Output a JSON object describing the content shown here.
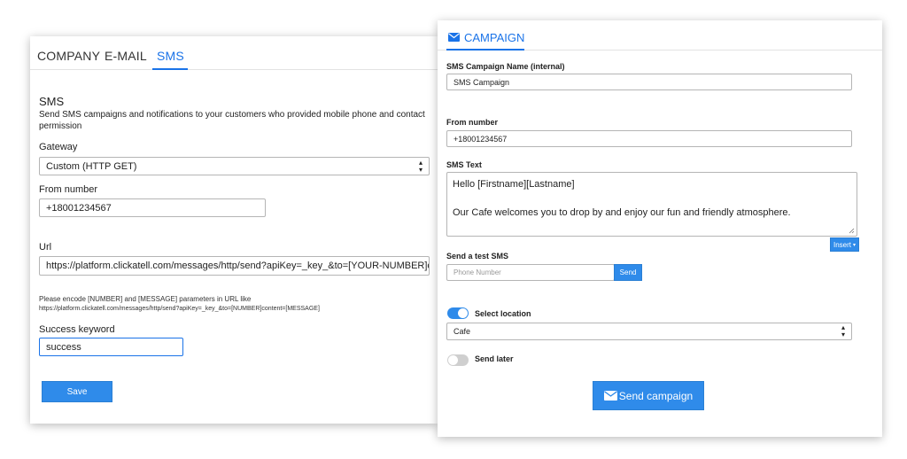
{
  "settings": {
    "tabs": [
      {
        "label": "COMPANY"
      },
      {
        "label": "E-MAIL"
      },
      {
        "label": "SMS",
        "active": true
      }
    ],
    "sms": {
      "heading": "SMS",
      "description_line1": "Send SMS campaigns and notifications to your customers who provided mobile phone and contact",
      "description_line2": "permission",
      "gateway_label": "Gateway",
      "gateway_value": "Custom (HTTP GET)",
      "from_number_label": "From number",
      "from_number_value": "+18001234567",
      "url_label": "Url",
      "url_value": "https://platform.clickatell.com/messages/http/send?apiKey=_key_&to=[YOUR-NUMBER]content=[Y(",
      "hint_line1": "Please encode [NUMBER] and [MESSAGE] parameters in URL like",
      "hint_line2": "https://platform.clickatell.com/messages/http/send?apiKey=_key_&to=[NUMBER]content=[MESSAGE]",
      "success_keyword_label": "Success keyword",
      "success_keyword_value": "success",
      "save_label": "Save"
    }
  },
  "campaign": {
    "title": "CAMPAIGN",
    "icon": "envelope-icon",
    "name_label": "SMS Campaign Name (internal)",
    "name_value": "SMS Campaign",
    "from_number_label": "From number",
    "from_number_value": "+18001234567",
    "sms_text_label": "SMS Text",
    "sms_text_line1": "Hello [Firstname][Lastname]",
    "sms_text_line2": "Our Cafe welcomes you to drop by and enjoy our fun and friendly atmosphere.",
    "insert_label": "Insert",
    "test_sms_label": "Send a test SMS",
    "phone_placeholder": "Phone Number",
    "send_label": "Send",
    "select_location_label": "Select location",
    "select_location_on": true,
    "location_value": "Cafe",
    "send_later_label": "Send later",
    "send_later_on": false,
    "send_campaign_label": "Send campaign"
  },
  "colors": {
    "accent": "#1a73e8",
    "button": "#2f8bea",
    "toggle_off": "#cfcfcf"
  }
}
